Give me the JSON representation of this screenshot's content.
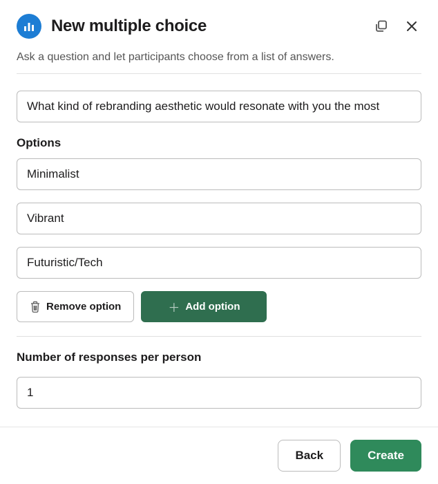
{
  "header": {
    "title": "New multiple choice"
  },
  "subtitle": "Ask a question and let participants choose from a list of answers.",
  "question": {
    "value": "What kind of rebranding aesthetic would resonate with you the most"
  },
  "options_label": "Options",
  "options": [
    {
      "value": "Minimalist"
    },
    {
      "value": "Vibrant"
    },
    {
      "value": "Futuristic/Tech"
    }
  ],
  "buttons": {
    "remove_option": "Remove option",
    "add_option": "Add option"
  },
  "responses": {
    "label": "Number of responses per person",
    "value": "1"
  },
  "footer": {
    "back": "Back",
    "create": "Create"
  }
}
